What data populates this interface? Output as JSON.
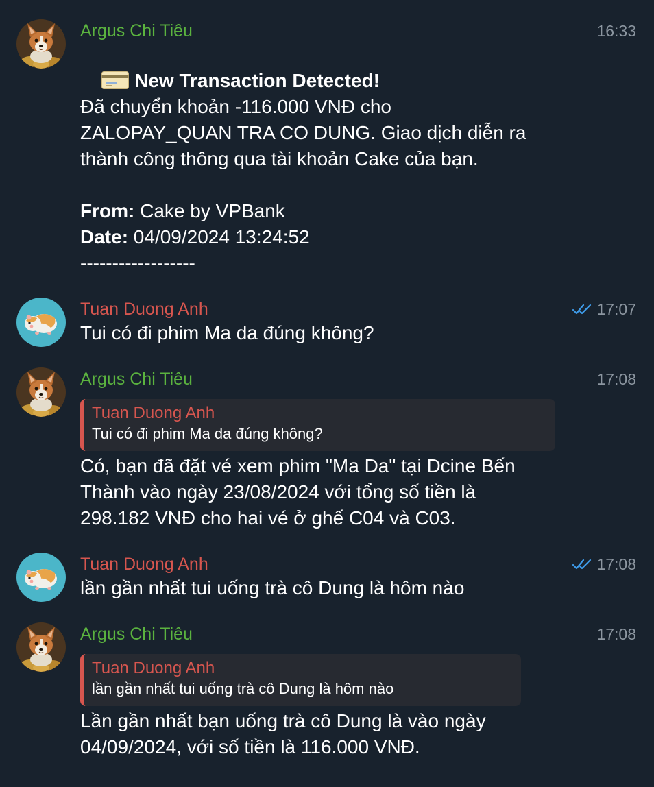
{
  "colors": {
    "background": "#18222d",
    "bot_name": "#5bb33f",
    "user_name": "#d7564f",
    "timestamp": "#8c96a0",
    "read_ticks": "#3e9be9",
    "quote_bg": "#272a31"
  },
  "messages": [
    {
      "sender": "Argus Chi Tiêu",
      "time": "16:33",
      "avatar_icon": "corgi-coins-avatar-icon",
      "title_icon": "credit-card-icon",
      "title": "New Transaction Detected!",
      "body_line1": "Đã chuyển khoản -116.000 VNĐ cho",
      "body_line2": "ZALOPAY_QUAN TRA CO DUNG. Giao dịch diễn ra",
      "body_line3": "thành công thông qua tài khoản Cake của bạn.",
      "from_label": "From:",
      "from_value": " Cake by VPBank",
      "date_label": "Date:",
      "date_value": " 04/09/2024 13:24:52",
      "separator": "------------------"
    },
    {
      "sender": "Tuan Duong Anh",
      "time": "17:07",
      "avatar_icon": "hamster-avatar-icon",
      "status_icon": "double-check-icon",
      "text": "Tui có đi phim Ma da đúng không?"
    },
    {
      "sender": "Argus Chi Tiêu",
      "time": "17:08",
      "avatar_icon": "corgi-coins-avatar-icon",
      "reply_to_name": "Tuan Duong Anh",
      "reply_to_text": "Tui có đi phim Ma da đúng không?",
      "line1": "Có, bạn đã đặt vé xem phim \"Ma Da\" tại Dcine Bến",
      "line2": "Thành vào ngày 23/08/2024 với tổng số tiền là",
      "line3": "298.182 VNĐ cho hai vé ở ghế C04 và C03."
    },
    {
      "sender": "Tuan Duong Anh",
      "time": "17:08",
      "avatar_icon": "hamster-avatar-icon",
      "status_icon": "double-check-icon",
      "text": "lần gần nhất tui uống trà cô Dung là hôm nào"
    },
    {
      "sender": "Argus Chi Tiêu",
      "time": "17:08",
      "avatar_icon": "corgi-coins-avatar-icon",
      "reply_to_name": "Tuan Duong Anh",
      "reply_to_text": "lần gần nhất tui uống trà cô Dung là hôm nào",
      "line1": "Lần gần nhất bạn uống trà cô Dung là vào ngày",
      "line2": "04/09/2024, với số tiền là 116.000 VNĐ."
    }
  ]
}
